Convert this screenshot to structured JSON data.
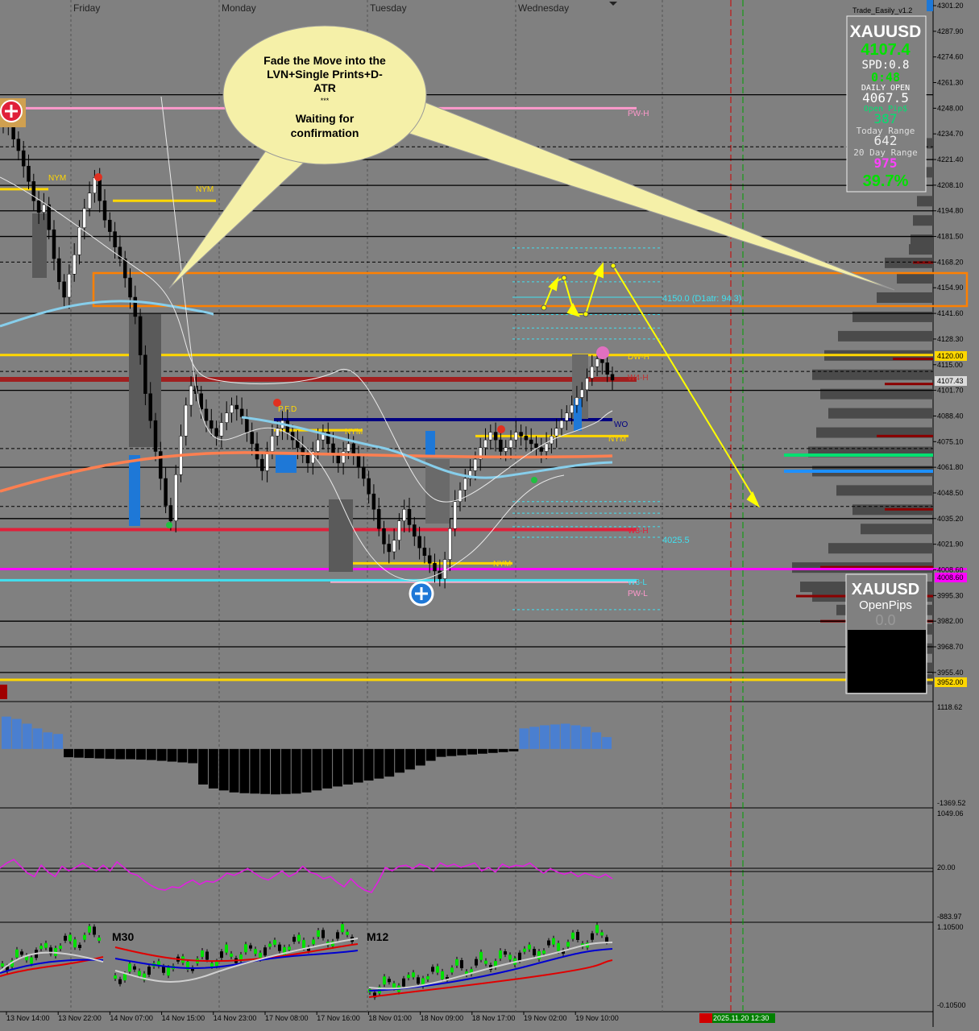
{
  "window": {
    "indicator_name": "Trade_Easily_v1.2",
    "day_labels": [
      "Friday",
      "Monday",
      "Tuesday",
      "Wednesday"
    ]
  },
  "info_panel": {
    "symbol": "XAUUSD",
    "price": "4107.4",
    "spread": "SPD:0.8",
    "timer": "0:48",
    "daily_open_label": "DAILY OPEN",
    "daily_open": "4067.5",
    "open_pips_label": "Open Pip$",
    "open_pips": "387",
    "today_range_label": "Today Range",
    "today_range": "642",
    "day20_range_label": "20 Day Range",
    "day20_range": "975",
    "percent": "39.7%"
  },
  "info_panel2": {
    "symbol": "XAUUSD",
    "open_pips_label": "OpenPips",
    "open_pips": "0.0"
  },
  "callout": {
    "line1": "Fade the Move into the",
    "line2": "LVN+Single Prints+D-",
    "line3": "ATR",
    "line4": "***",
    "line5": "Waiting for",
    "line6": "confirmation"
  },
  "level_labels": {
    "pwh": "PW-H",
    "pwl": "PW-L",
    "nym": "NYM",
    "wo": "WO",
    "w4h": "W4-H",
    "w3l": "W3-L",
    "w3h": "W3-H",
    "dwh": "DW-H",
    "datr_top": "4150.0 (D1atr: 94.3)",
    "datr_bottom": "4025.5",
    "pfd": "P.F.D"
  },
  "price_badges": {
    "b4120": "4120.00",
    "b4107": "4107.43",
    "b4008": "4008.60",
    "b3952": "3952.00"
  },
  "colors": {
    "background": "#808080",
    "grid": "#505050",
    "callout_fill": "#f5f0a8",
    "zone": "#ff8000",
    "arrow": "#ffff00",
    "pink": "#ff99cc",
    "red_level": "#e0203a",
    "yellow_level": "#ffd700",
    "magenta": "#ff00ff",
    "blue_level": "#000080"
  },
  "chart_data": [
    {
      "type": "line",
      "name": "main",
      "symbol": "XAUUSD",
      "y_ticks": [
        "4301.20",
        "4287.90",
        "4274.60",
        "4261.30",
        "4248.00",
        "4234.70",
        "4221.40",
        "4208.10",
        "4194.80",
        "4181.50",
        "4168.20",
        "4154.90",
        "4141.60",
        "4128.30",
        "4115.00",
        "4101.70",
        "4088.40",
        "4075.10",
        "4061.80",
        "4048.50",
        "4035.20",
        "4021.90",
        "4008.60",
        "3995.30",
        "3982.00",
        "3968.70",
        "3955.40"
      ],
      "ylim": [
        3952,
        4301.2
      ],
      "close_series": [
        4240,
        4246,
        4232,
        4226,
        4218,
        4210,
        4200,
        4194,
        4198,
        4185,
        4170,
        4158,
        4150,
        4162,
        4172,
        4186,
        4196,
        4204,
        4212,
        4200,
        4190,
        4184,
        4176,
        4170,
        4160,
        4150,
        4140,
        4120,
        4100,
        4086,
        4070,
        4056,
        4042,
        4034,
        4058,
        4078,
        4094,
        4104,
        4100,
        4092,
        4086,
        4082,
        4078,
        4085,
        4090,
        4094,
        4092,
        4088,
        4080,
        4074,
        4066,
        4060,
        4070,
        4078,
        4082,
        4086,
        4080,
        4076,
        4072,
        4068,
        4064,
        4070,
        4076,
        4080,
        4074,
        4068,
        4064,
        4070,
        4074,
        4068,
        4062,
        4056,
        4048,
        4040,
        4030,
        4022,
        4018,
        4024,
        4034,
        4040,
        4032,
        4026,
        4020,
        4016,
        4012,
        4008,
        4004,
        4014,
        4030,
        4044,
        4050,
        4056,
        4060,
        4066,
        4072,
        4076,
        4080,
        4076,
        4070,
        4072,
        4076,
        4080,
        4078,
        4076,
        4074,
        4072,
        4070,
        4074,
        4078,
        4082,
        4086,
        4090,
        4094,
        4098,
        4102,
        4108,
        4114,
        4118,
        4116,
        4110,
        4107
      ],
      "levels": {
        "pw_h": 4248,
        "pw_l": 4002.5,
        "nym": 4207.5,
        "datr_high": 4150,
        "datr_low": 4025.5,
        "level_4120": 4120,
        "w4_h": 4107.4,
        "wo": 4086.5,
        "w3_l": 4004.5,
        "w3_h": 4029.5,
        "yellow_bottom": 3952
      },
      "zone": [
        4145,
        4161
      ],
      "arrow_path": [
        [
          4145,
          4158
        ],
        [
          4158,
          4142
        ],
        [
          4165,
          4034
        ]
      ]
    },
    {
      "type": "bar",
      "name": "histogram",
      "y_ticks": [
        "1118.62",
        "-1369.52"
      ],
      "ylim": [
        -1369.52,
        1118.62
      ],
      "values": [
        820,
        760,
        640,
        520,
        420,
        380,
        -210,
        -220,
        -230,
        -240,
        -250,
        -260,
        -260,
        -270,
        -280,
        -300,
        -320,
        -340,
        -360,
        -900,
        -1000,
        -1050,
        -1100,
        -1120,
        -1130,
        -1140,
        -1150,
        -1140,
        -1130,
        -1100,
        -1050,
        -1000,
        -950,
        -900,
        -850,
        -800,
        -750,
        -700,
        -600,
        -520,
        -420,
        -300,
        -200,
        -180,
        -160,
        -140,
        -120,
        -100,
        -80,
        -60,
        520,
        560,
        600,
        620,
        640,
        600,
        560,
        420,
        300
      ]
    },
    {
      "type": "line",
      "name": "oscillator",
      "y_ticks": [
        "1049.06",
        "20.00",
        "-883.97"
      ],
      "ylim": [
        -883.97,
        1049.06
      ],
      "values": [
        30,
        120,
        180,
        60,
        -60,
        -120,
        80,
        -40,
        -120,
        60,
        -20,
        40,
        120,
        40,
        -20,
        80,
        -20,
        140,
        40,
        -60,
        -100,
        -200,
        -280,
        -340,
        -360,
        -300,
        -320,
        -240,
        -180,
        -260,
        -200,
        -220,
        -160,
        -60,
        -100,
        -40,
        20,
        -60,
        -140,
        -180,
        -100,
        -20,
        -120,
        -60,
        60,
        -40,
        -80,
        -160,
        -120,
        -220,
        -300,
        -160,
        -280,
        -360,
        -400,
        -200,
        40,
        -20,
        60,
        80,
        20,
        100,
        60,
        -20,
        120,
        60,
        100,
        40,
        80,
        120,
        -20,
        40,
        -40,
        100,
        40,
        80,
        60,
        120,
        20,
        -60,
        20,
        -40,
        -80,
        -40,
        -120,
        -60,
        -100,
        -140,
        -80,
        -160
      ]
    },
    {
      "type": "line",
      "name": "multi_timeframe",
      "y_ticks": [
        "1.10500",
        "-0.10500"
      ],
      "ylim": [
        -0.105,
        1.105
      ],
      "labels": [
        "M30",
        "M12"
      ],
      "x_ticks": [
        "13 Nov 14:00",
        "13 Nov 22:00",
        "14 Nov 07:00",
        "14 Nov 15:00",
        "14 Nov 23:00",
        "17 Nov 08:00",
        "17 Nov 16:00",
        "18 Nov 01:00",
        "18 Nov 09:00",
        "18 Nov 17:00",
        "19 Nov 02:00",
        "19 Nov 10:00"
      ],
      "footer_text": "2025.11.20 12:30"
    }
  ]
}
